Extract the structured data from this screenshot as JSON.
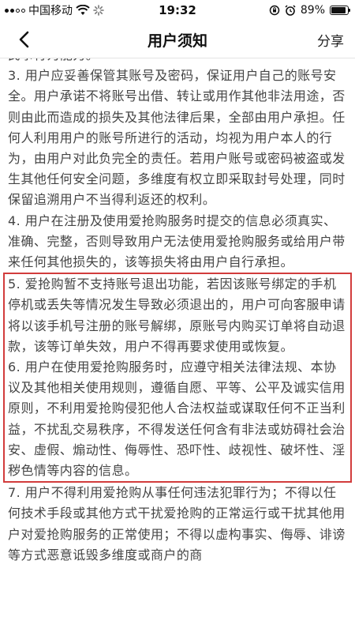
{
  "status_bar": {
    "carrier": "中国移动",
    "time": "19:32",
    "battery_percent": "89%",
    "battery_level": 0.89
  },
  "nav": {
    "title": "用户须知",
    "share_label": "分享"
  },
  "content": {
    "partial_top": "民事行为能力。",
    "item3": "3. 用户应妥善保管其账号及密码，保证用户自己的账号安全。用户承诺不将账号出借、转让或用作其他非法用途，否则由此而造成的损失及其他法律后果，全部由用户承担。任何人利用用户的账号所进行的活动，均视为用户本人的行为，由用户对此负完全的责任。若用户账号或密码被盗或发生其他任何安全问题，多维度有权立即采取封号处理，同时保留追溯用户不当得利返还的权利。",
    "item4": "4. 用户在注册及使用爱抢购服务时提交的信息必须真实、准确、完整，否则导致用户无法使用爱抢购服务或给用户带来任何其他损失的，该等损失将由用户自行承担。",
    "item5": "5. 爱抢购暂不支持账号退出功能，若因该账号绑定的手机停机或丢失等情况发生导致必须退出的，用户可向客服申请将以该手机号注册的账号解绑，原账号内购买订单将自动退款，该等订单失效，用户不得再要求使用或恢复。",
    "item6": "6. 用户在使用爱抢购服务时，应遵守相关法律法规、本协议及其他相关使用规则，遵循自愿、平等、公平及诚实信用原则，不利用爱抢购侵犯他人合法权益或谋取任何不正当利益，不扰乱交易秩序，不得发送任何含有非法或妨碍社会治安、虚假、煽动性、侮辱性、恐吓性、歧视性、破坏性、淫秽色情等内容的信息。",
    "item7": "7. 用户不得利用爱抢购从事任何违法犯罪行为；不得以任何技术手段或其他方式干扰爱抢购的正常运行或干扰其他用户对爱抢购服务的正常使用；不得以虚构事实、侮辱、诽谤等方式恶意诋毁多维度或商户的商"
  }
}
